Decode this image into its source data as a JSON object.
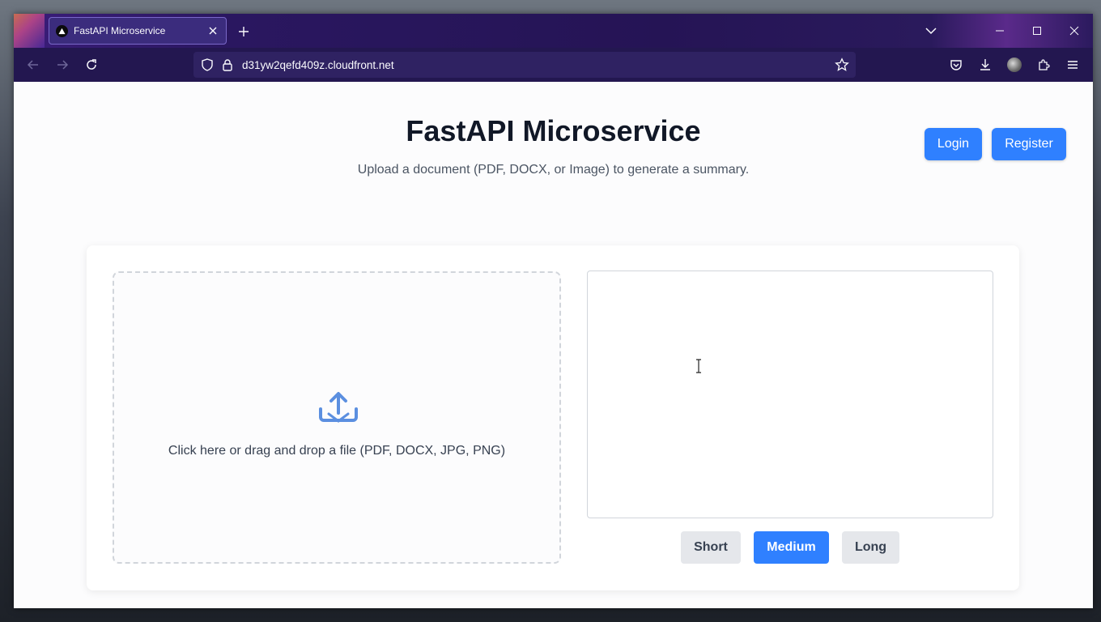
{
  "browser": {
    "tab_title": "FastAPI Microservice",
    "url": "d31yw2qefd409z.cloudfront.net"
  },
  "icons": {
    "favicon": "triangle-logo-icon",
    "new_tab": "plus-icon",
    "tab_close": "close-icon",
    "back": "arrow-left-icon",
    "forward": "arrow-right-icon",
    "reload": "reload-icon",
    "shield": "shield-icon",
    "lock": "lock-icon",
    "bookmark": "star-icon",
    "pocket": "pocket-icon",
    "downloads": "download-icon",
    "account": "avatar-icon",
    "extensions": "puzzle-icon",
    "menu": "hamburger-icon",
    "upload": "upload-icon"
  },
  "header": {
    "title": "FastAPI Microservice",
    "subtitle": "Upload a document (PDF, DOCX, or Image) to generate a summary.",
    "login_label": "Login",
    "register_label": "Register"
  },
  "upload": {
    "prompt": "Click here or drag and drop a file (PDF, DOCX, JPG, PNG)"
  },
  "summary": {
    "value": "",
    "length_options": [
      "Short",
      "Medium",
      "Long"
    ],
    "selected": "Medium"
  },
  "colors": {
    "primary": "#2f80ff",
    "secondary_button": "#e5e7eb",
    "title": "#111827",
    "browser_chrome": "#231750"
  }
}
